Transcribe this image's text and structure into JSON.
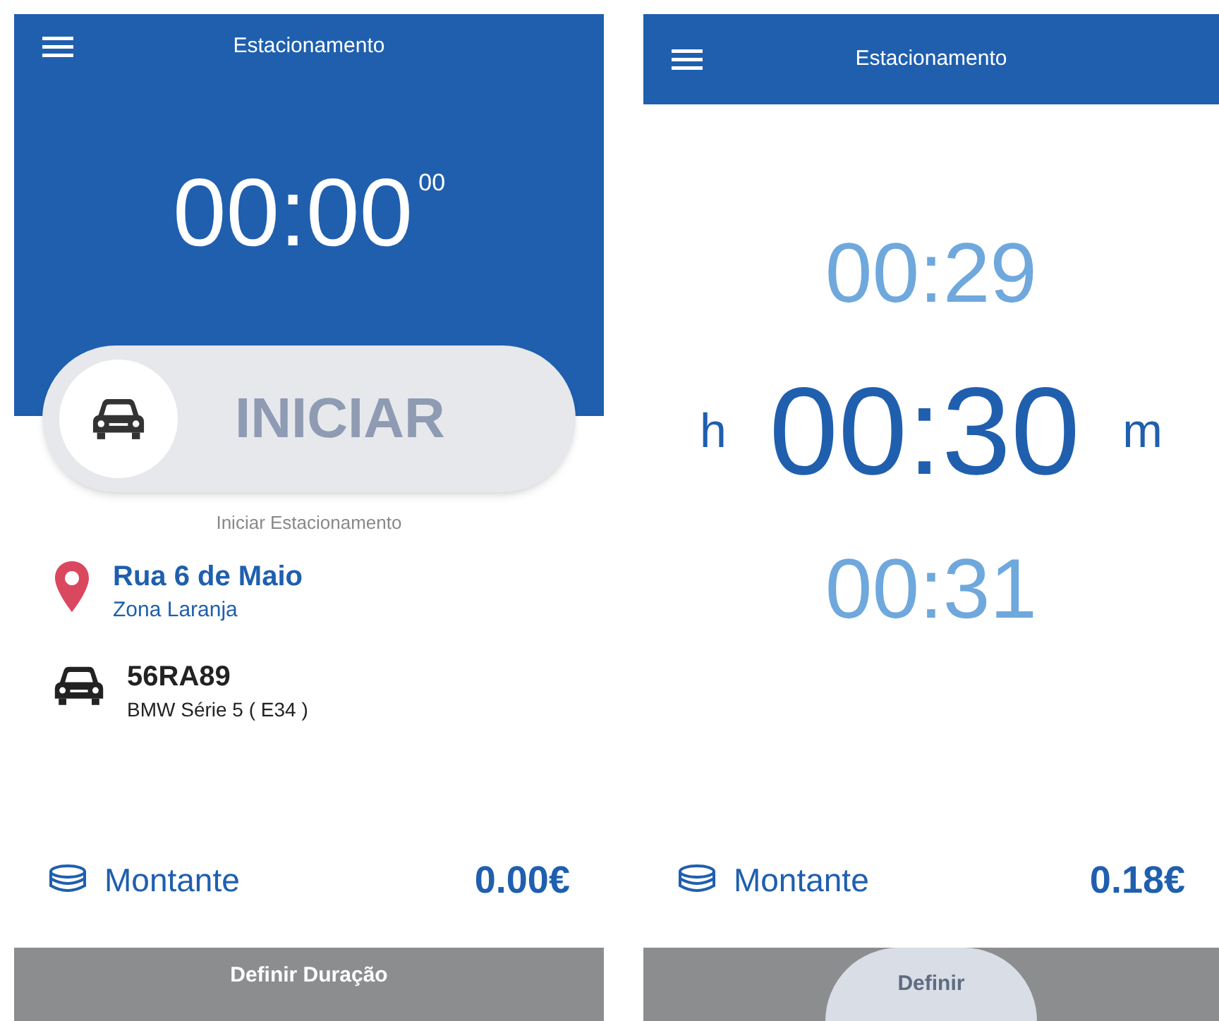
{
  "screens": [
    {
      "kind": "start",
      "header": {
        "title": "Estacionamento"
      },
      "timer": {
        "main": "00:00",
        "seconds": "00"
      },
      "start_button": {
        "label": "INICIAR"
      },
      "caption": "Iniciar Estacionamento",
      "location": {
        "street": "Rua 6 de Maio",
        "zone": "Zona Laranja"
      },
      "vehicle": {
        "plate": "56RA89",
        "model": "BMW Série 5 ( E34 )"
      },
      "amount": {
        "label": "Montante",
        "value": "0.00€"
      },
      "action_button": "Definir Duração"
    },
    {
      "kind": "duration",
      "header": {
        "title": "Estacionamento"
      },
      "picker": {
        "hours_unit": "h",
        "minutes_unit": "m",
        "options": [
          {
            "value": "00:29",
            "selected": false
          },
          {
            "value": "00:30",
            "selected": true
          },
          {
            "value": "00:31",
            "selected": false
          }
        ]
      },
      "amount": {
        "label": "Montante",
        "value": "0.18€"
      },
      "action_button": "Definir"
    }
  ]
}
